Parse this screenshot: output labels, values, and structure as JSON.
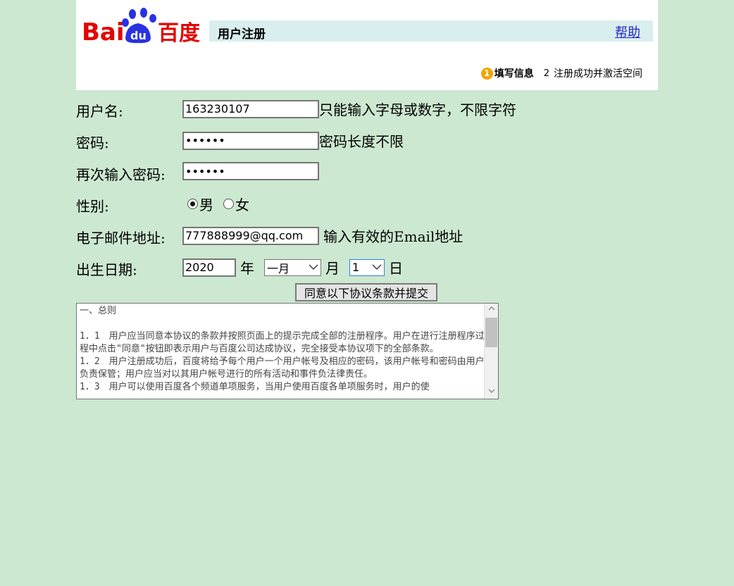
{
  "header": {
    "logo_text": "Bai百度",
    "title": "用户注册",
    "help_link": "帮助",
    "step1_number": "1",
    "step1_label": "填写信息",
    "step2_number": "2",
    "step2_label": "注册成功并激活空间"
  },
  "form": {
    "username": {
      "label": "用户名:",
      "value": "163230107",
      "hint": "只能输入字母或数字，不限字符"
    },
    "password": {
      "label": "密码:",
      "value": "••••••",
      "hint": "密码长度不限"
    },
    "password_confirm": {
      "label": "再次输入密码:",
      "value": "••••••"
    },
    "gender": {
      "label": "性别:",
      "option_male": "男",
      "option_female": "女",
      "selected": "男"
    },
    "email": {
      "label": "电子邮件地址:",
      "value": "777888999@qq.com",
      "hint": "输入有效的Email地址"
    },
    "birthdate": {
      "label": "出生日期:",
      "year_value": "2020",
      "year_unit": "年",
      "month_value": "一月",
      "month_unit": "月",
      "day_value": "1",
      "day_unit": "日"
    },
    "submit_label": "同意以下协议条款并提交"
  },
  "agreement": {
    "text": "一、总则\n\n1．1　用户应当同意本协议的条款并按照页面上的提示完成全部的注册程序。用户在进行注册程序过程中点击\"同意\"按钮即表示用户与百度公司达成协议，完全接受本协议项下的全部条款。\n1．2　用户注册成功后，百度将给予每个用户一个用户帐号及相应的密码，该用户帐号和密码由用户负责保管；用户应当对以其用户帐号进行的所有活动和事件负法律责任。\n1．3　用户可以使用百度各个频道单项服务，当用户使用百度各单项服务时，用户的使"
  },
  "colors": {
    "background": "#cce8d0",
    "title_bar": "#d9eeee",
    "baidu_red": "#e10602",
    "baidu_blue": "#2932e1",
    "step_orange": "#f5a300"
  }
}
